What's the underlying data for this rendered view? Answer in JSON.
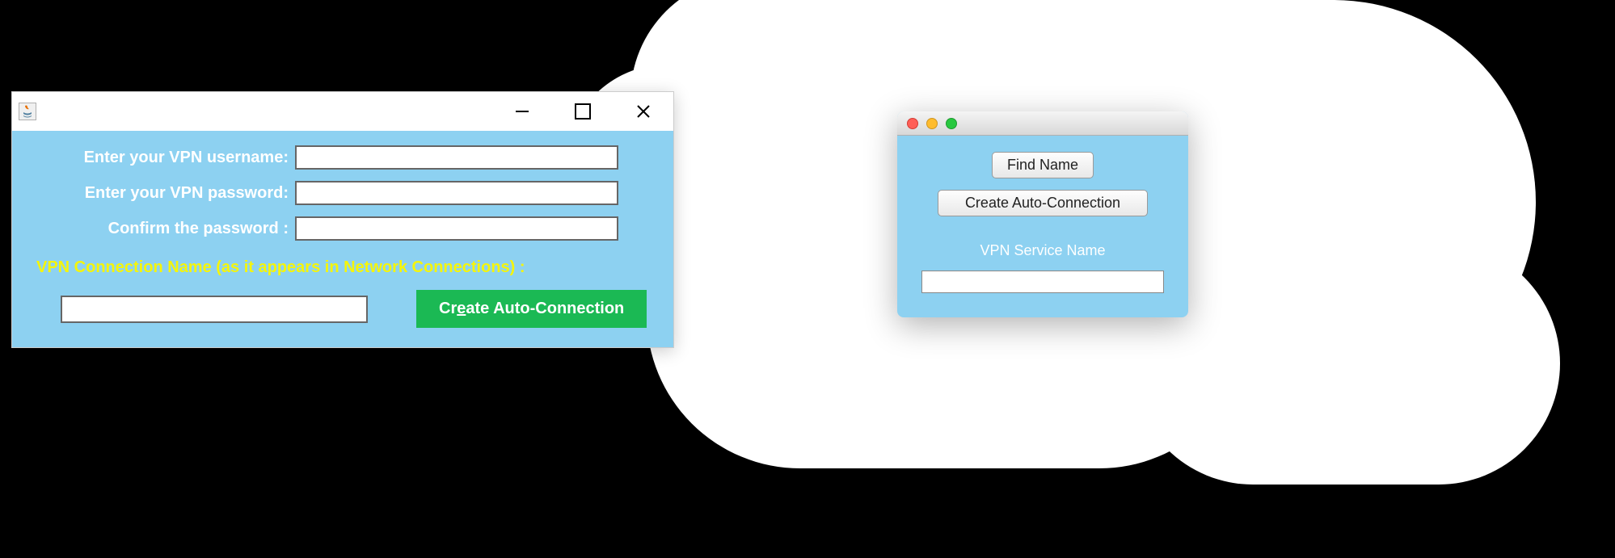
{
  "colors": {
    "panel_bg": "#8dd1f1",
    "button_green": "#1bb954",
    "highlight_yellow": "#f5f50a"
  },
  "win": {
    "icon_name": "java-icon",
    "labels": {
      "username": "Enter your VPN username:",
      "password": "Enter your VPN password:",
      "confirm": "Confirm the password :",
      "connection_name": "VPN Connection Name (as it appears in Network Connections) :"
    },
    "values": {
      "username": "",
      "password": "",
      "confirm": "",
      "connection_name": ""
    },
    "button": "Create Auto-Connection"
  },
  "mac": {
    "buttons": {
      "find": "Find Name",
      "create": "Create Auto-Connection"
    },
    "label": "VPN Service Name",
    "value": ""
  }
}
